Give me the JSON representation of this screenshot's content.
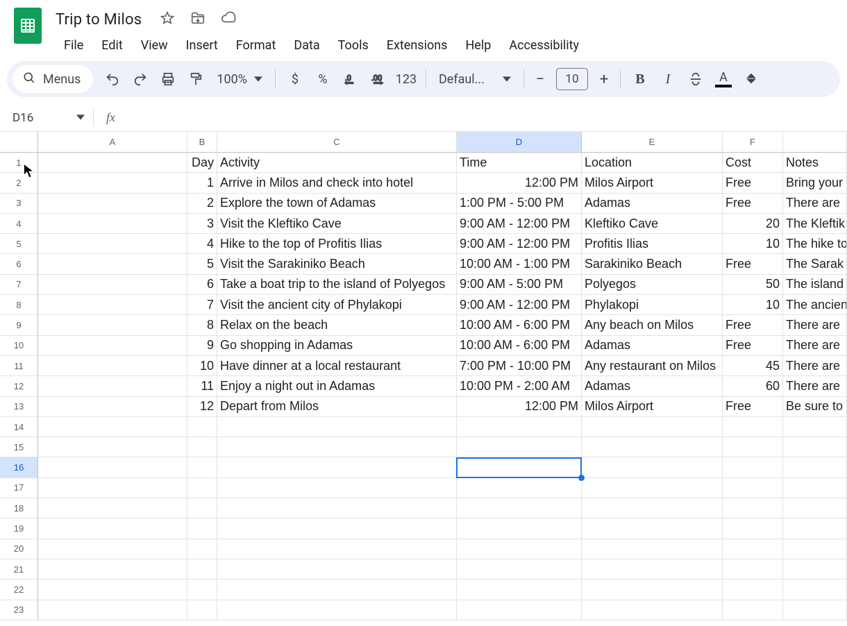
{
  "doc": {
    "title": "Trip to Milos"
  },
  "menubar": {
    "file": "File",
    "edit": "Edit",
    "view": "View",
    "insert": "Insert",
    "format": "Format",
    "data": "Data",
    "tools": "Tools",
    "extensions": "Extensions",
    "help": "Help",
    "accessibility": "Accessibility"
  },
  "toolbar": {
    "search_label": "Menus",
    "zoom": "100%",
    "currency": "$",
    "percent": "%",
    "dec_less": ".0",
    "dec_more": ".00",
    "numfmt": "123",
    "font": "Defaul...",
    "font_size": "10",
    "bold": "B",
    "italic": "I",
    "textcolor": "A"
  },
  "namebox": {
    "ref": "D16"
  },
  "fx": {
    "label": "fx"
  },
  "columns": [
    "A",
    "B",
    "C",
    "D",
    "E",
    "F"
  ],
  "selected_col_index": 3,
  "selected_row_index": 15,
  "total_rows": 23,
  "sheet": {
    "headers": {
      "B": "Day",
      "C": "Activity",
      "D": "Time",
      "E": "Location",
      "F": "Cost",
      "G": "Notes"
    },
    "rows": [
      {
        "day": "1",
        "activity": "Arrive in Milos and check into hotel",
        "time": "12:00 PM",
        "location": "Milos Airport",
        "cost": "Free",
        "cost_num": false,
        "notes": "Bring your"
      },
      {
        "day": "2",
        "activity": "Explore the town of Adamas",
        "time": "1:00 PM - 5:00 PM",
        "location": "Adamas",
        "cost": "Free",
        "cost_num": false,
        "notes": "There are"
      },
      {
        "day": "3",
        "activity": "Visit the Kleftiko Cave",
        "time": "9:00 AM - 12:00 PM",
        "location": "Kleftiko Cave",
        "cost": "20",
        "cost_num": true,
        "notes": "The Kleftik"
      },
      {
        "day": "4",
        "activity": "Hike to the top of Profitis Ilias",
        "time": "9:00 AM - 12:00 PM",
        "location": "Profitis Ilias",
        "cost": "10",
        "cost_num": true,
        "notes": "The hike to"
      },
      {
        "day": "5",
        "activity": "Visit the Sarakiniko Beach",
        "time": "10:00 AM - 1:00 PM",
        "location": "Sarakiniko Beach",
        "cost": "Free",
        "cost_num": false,
        "notes": "The Sarak"
      },
      {
        "day": "6",
        "activity": "Take a boat trip to the island of Polyegos",
        "time": "9:00 AM - 5:00 PM",
        "location": "Polyegos",
        "cost": "50",
        "cost_num": true,
        "notes": "The island"
      },
      {
        "day": "7",
        "activity": "Visit the ancient city of Phylakopi",
        "time": "9:00 AM - 12:00 PM",
        "location": "Phylakopi",
        "cost": "10",
        "cost_num": true,
        "notes": "The ancien"
      },
      {
        "day": "8",
        "activity": "Relax on the beach",
        "time": "10:00 AM - 6:00 PM",
        "location": "Any beach on Milos",
        "cost": "Free",
        "cost_num": false,
        "notes": "There are"
      },
      {
        "day": "9",
        "activity": "Go shopping in Adamas",
        "time": "10:00 AM - 6:00 PM",
        "location": "Adamas",
        "cost": "Free",
        "cost_num": false,
        "notes": "There are"
      },
      {
        "day": "10",
        "activity": "Have dinner at a local restaurant",
        "time": "7:00 PM - 10:00 PM",
        "location": "Any restaurant on Milos",
        "cost": "45",
        "cost_num": true,
        "notes": "There are"
      },
      {
        "day": "11",
        "activity": "Enjoy a night out in Adamas",
        "time": "10:00 PM - 2:00 AM",
        "location": "Adamas",
        "cost": "60",
        "cost_num": true,
        "notes": "There are"
      },
      {
        "day": "12",
        "activity": "Depart from Milos",
        "time": "12:00 PM",
        "location": "Milos Airport",
        "cost": "Free",
        "cost_num": false,
        "notes": "Be sure to"
      }
    ]
  }
}
